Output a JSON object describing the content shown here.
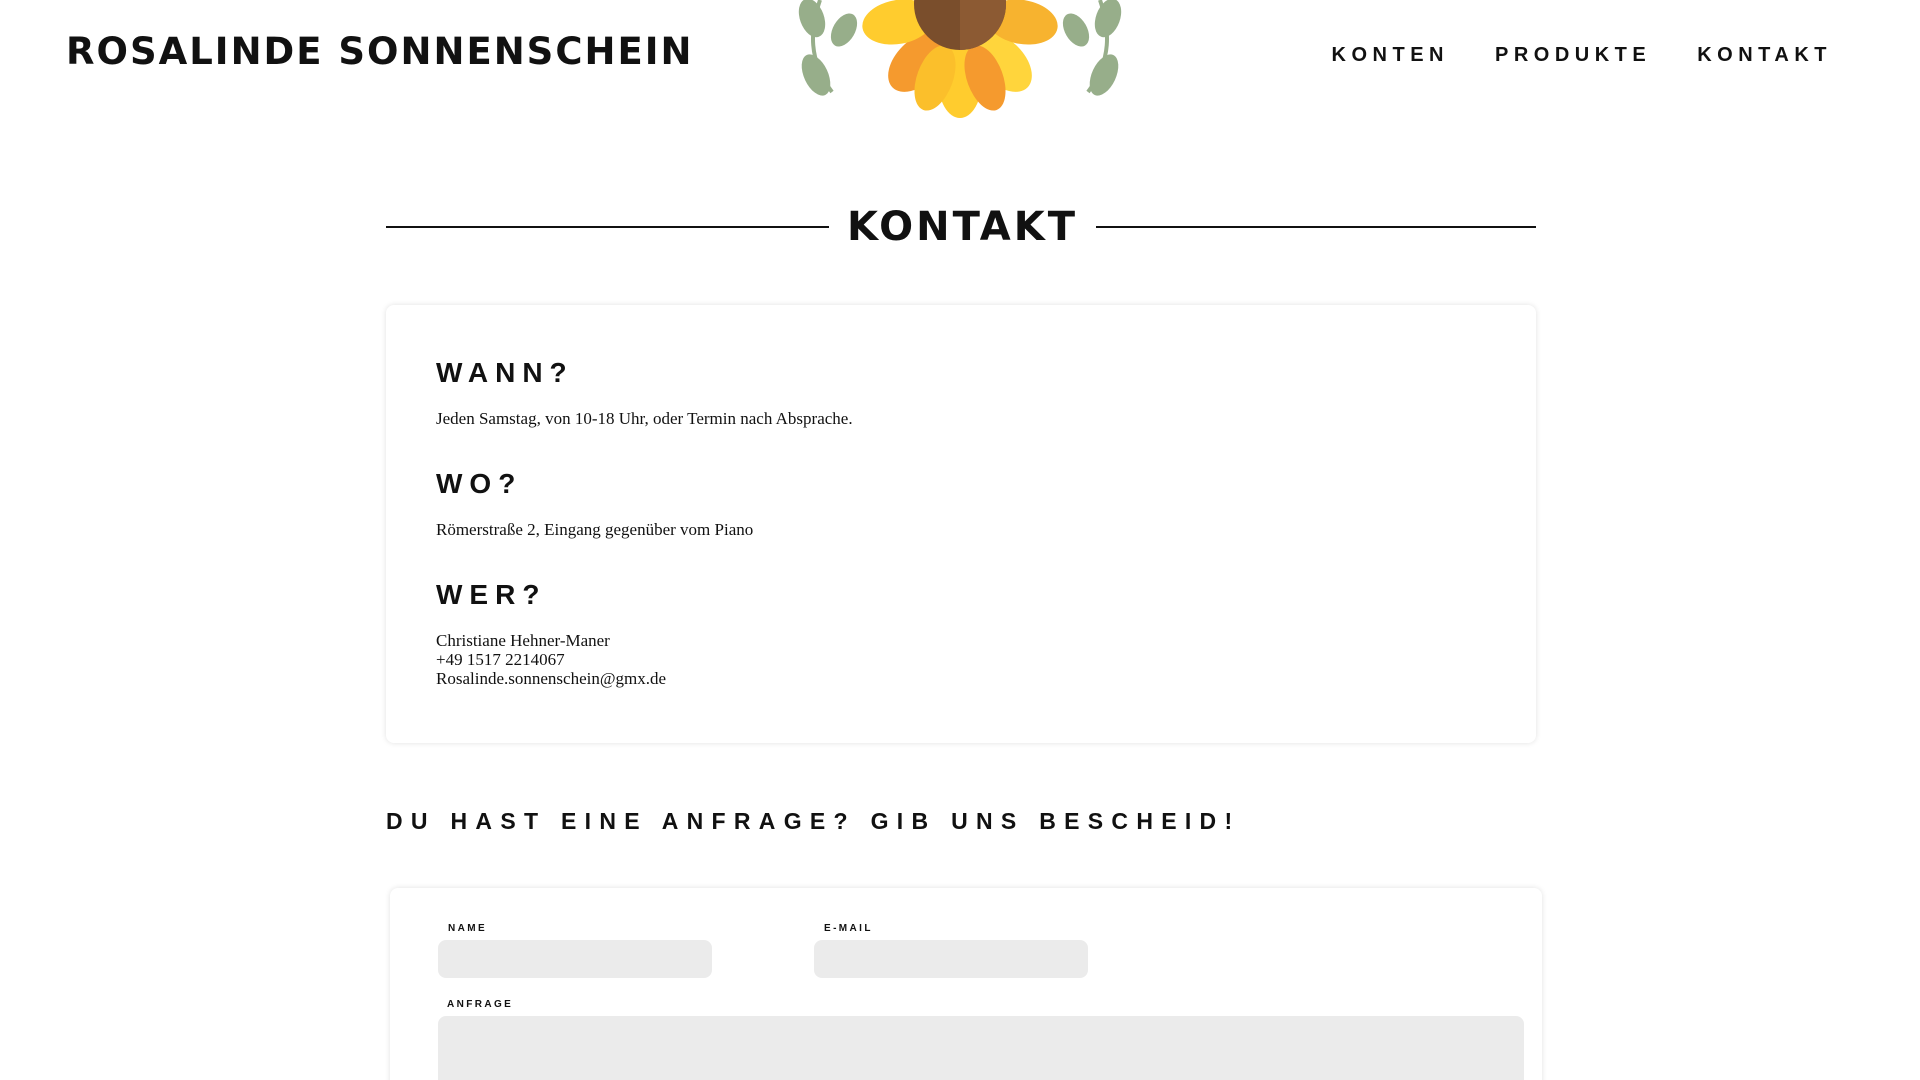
{
  "header": {
    "brand": "ROSALINDE SONNENSCHEIN",
    "nav": [
      "KONTEN",
      "PRODUKTE",
      "KONTAKT"
    ],
    "decoration_icon": "sunflower-icon"
  },
  "section": {
    "title": "KONTAKT"
  },
  "info": {
    "when": {
      "heading": "WANN?",
      "text": "Jeden Samstag, von 10-18 Uhr, oder Termin nach Absprache."
    },
    "where": {
      "heading": "WO?",
      "text": "Römerstraße 2, Eingang gegenüber vom Piano"
    },
    "who": {
      "heading": "WER?",
      "name": "Christiane Hehner-Maner",
      "phone": "+49 1517 2214067",
      "email": "Rosalinde.sonnenschein@gmx.de"
    }
  },
  "form": {
    "heading": "DU HAST EINE ANFRAGE? GIB UNS BESCHEID!",
    "name_label": "NAME",
    "email_label": "E-MAIL",
    "message_label": "ANFRAGE",
    "name_value": "",
    "email_value": "",
    "message_value": ""
  },
  "colors": {
    "petal_yellow": "#FFCC2E",
    "petal_orange": "#F59A2E",
    "flower_center": "#7A4E2C",
    "leaf_green": "#97AE8A",
    "field_background": "#EBEBEB"
  }
}
